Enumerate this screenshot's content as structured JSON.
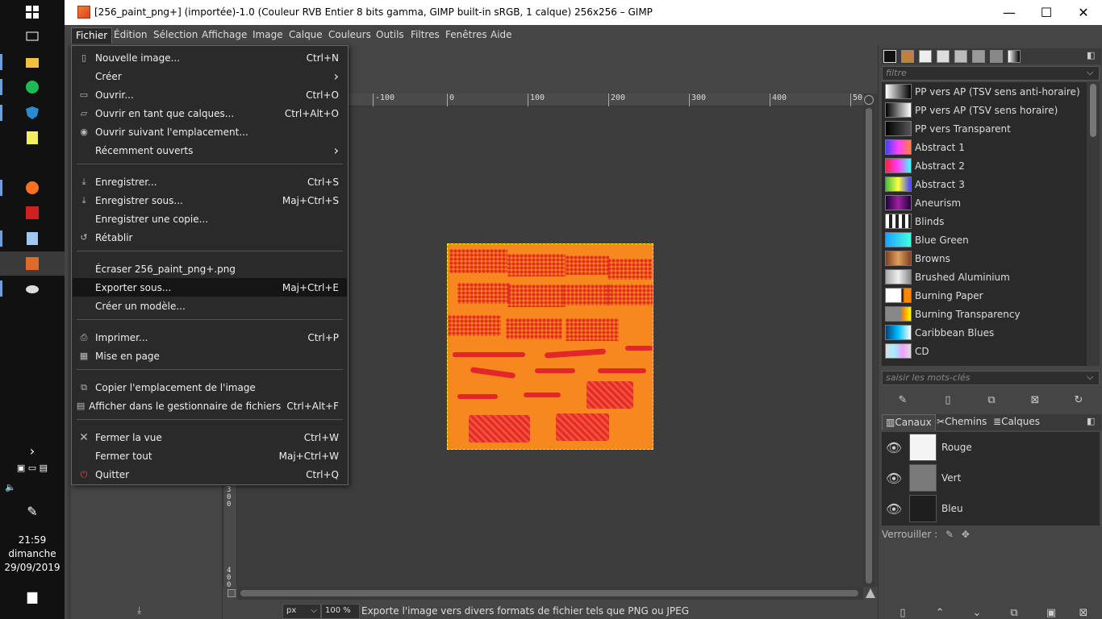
{
  "window": {
    "title": "[256_paint_png+] (importée)-1.0 (Couleur RVB Entier 8 bits gamma, GIMP built-in sRGB, 1 calque) 256x256 – GIMP",
    "minimize": "—",
    "maximize": "☐",
    "close": "✕"
  },
  "menubar": [
    "Fichier",
    "Édition",
    "Sélection",
    "Affichage",
    "Image",
    "Calque",
    "Couleurs",
    "Outils",
    "Filtres",
    "Fenêtres",
    "Aide"
  ],
  "file_menu": [
    {
      "label": "Nouvelle image...",
      "shortcut": "Ctrl+N",
      "icon": "new-image-icon"
    },
    {
      "label": "Créer",
      "shortcut": "›",
      "icon": "create-icon"
    },
    {
      "label": "Ouvrir...",
      "shortcut": "Ctrl+O",
      "icon": "open-icon"
    },
    {
      "label": "Ouvrir en tant que calques...",
      "shortcut": "Ctrl+Alt+O",
      "icon": "open-as-layers-icon"
    },
    {
      "label": "Ouvrir suivant l'emplacement...",
      "shortcut": "",
      "icon": "globe-icon"
    },
    {
      "label": "Récemment ouverts",
      "shortcut": "›",
      "icon": "recent-icon"
    },
    {
      "label": "Enregistrer...",
      "shortcut": "Ctrl+S",
      "icon": "save-icon"
    },
    {
      "label": "Enregistrer sous...",
      "shortcut": "Maj+Ctrl+S",
      "icon": "save-as-icon"
    },
    {
      "label": "Enregistrer une copie...",
      "shortcut": "",
      "icon": "save-copy-icon"
    },
    {
      "label": "Rétablir",
      "shortcut": "",
      "icon": "revert-icon"
    },
    {
      "label": "Écraser 256_paint_png+.png",
      "shortcut": "",
      "icon": "overwrite-icon"
    },
    {
      "label": "Exporter sous...",
      "shortcut": "Maj+Ctrl+E",
      "icon": "export-icon"
    },
    {
      "label": "Créer un modèle...",
      "shortcut": "",
      "icon": "template-icon"
    },
    {
      "label": "Imprimer...",
      "shortcut": "Ctrl+P",
      "icon": "print-icon"
    },
    {
      "label": "Mise en page",
      "shortcut": "",
      "icon": "page-setup-icon"
    },
    {
      "label": "Copier l'emplacement de l'image",
      "shortcut": "",
      "icon": "copy-location-icon"
    },
    {
      "label": "Afficher dans le gestionnaire de fichiers",
      "shortcut": "Ctrl+Alt+F",
      "icon": "file-manager-icon"
    },
    {
      "label": "Fermer la vue",
      "shortcut": "Ctrl+W",
      "icon": "close-view-icon"
    },
    {
      "label": "Fermer tout",
      "shortcut": "Maj+Ctrl+W",
      "icon": "close-all-icon"
    },
    {
      "label": "Quitter",
      "shortcut": "Ctrl+Q",
      "icon": "quit-icon"
    }
  ],
  "ruler": {
    "ticks": [
      "-100",
      "0",
      "100",
      "200",
      "300",
      "400",
      "50"
    ],
    "vticks": [
      "3",
      "0",
      "0",
      "4",
      "0",
      "0"
    ]
  },
  "statusbar": {
    "unit": "px",
    "zoom": "100 %",
    "message": "Exporte l'image vers divers formats de fichier tels que PNG ou JPEG"
  },
  "dock": {
    "filter_placeholder": "filtre",
    "tags_placeholder": "saisir les mots-clés",
    "gradients": [
      {
        "name": "PP vers AP (TSV sens anti-horaire)",
        "css": "linear-gradient(90deg,#fff,#000)"
      },
      {
        "name": "PP vers AP (TSV sens horaire)",
        "css": "linear-gradient(90deg,#000,#fff)"
      },
      {
        "name": "PP vers Transparent",
        "css": "linear-gradient(90deg,#000,#555)"
      },
      {
        "name": "Abstract 1",
        "css": "linear-gradient(90deg,#4040ff,#ff40ff,#ff8040)"
      },
      {
        "name": "Abstract 2",
        "css": "linear-gradient(90deg,#ff2040,#ff40ff,#40ffff)"
      },
      {
        "name": "Abstract 3",
        "css": "linear-gradient(90deg,#40c040,#ffff40,#4040ff)"
      },
      {
        "name": "Aneurism",
        "css": "linear-gradient(90deg,#200040,#a020a0,#200040)"
      },
      {
        "name": "Blinds",
        "css": "repeating-linear-gradient(90deg,#fff 0 4px,#222 4px 8px)"
      },
      {
        "name": "Blue Green",
        "css": "linear-gradient(90deg,#20a0ff,#40ffe0)"
      },
      {
        "name": "Browns",
        "css": "linear-gradient(90deg,#804020,#e0a060,#804020)"
      },
      {
        "name": "Brushed Aluminium",
        "css": "linear-gradient(90deg,#aaa,#eee,#888)"
      },
      {
        "name": "Burning Paper",
        "css": "linear-gradient(90deg,#fff 60%,#000 65%,#f80 75%)"
      },
      {
        "name": "Burning Transparency",
        "css": "linear-gradient(90deg,#888 60%,#f80 70%,#ff0)"
      },
      {
        "name": "Caribbean Blues",
        "css": "linear-gradient(90deg,#004080,#00c0ff,#fff)"
      },
      {
        "name": "CD",
        "css": "linear-gradient(90deg,#ddd,#a0f0ff,#f0a0ff,#ddd)"
      }
    ],
    "channel_tabs": [
      "Canaux",
      "Chemins",
      "Calques"
    ],
    "channels": [
      {
        "name": "Rouge",
        "thumb": "#f4f4f4"
      },
      {
        "name": "Vert",
        "thumb": "#7a7a7a"
      },
      {
        "name": "Bleu",
        "thumb": "#1e1e1e"
      }
    ],
    "lock_label": "Verrouiller :"
  },
  "taskbar": {
    "time": "21:59",
    "day": "dimanche",
    "date": "29/09/2019"
  },
  "colors": {
    "accent": "#f7881f",
    "paint": "#e3262a"
  }
}
